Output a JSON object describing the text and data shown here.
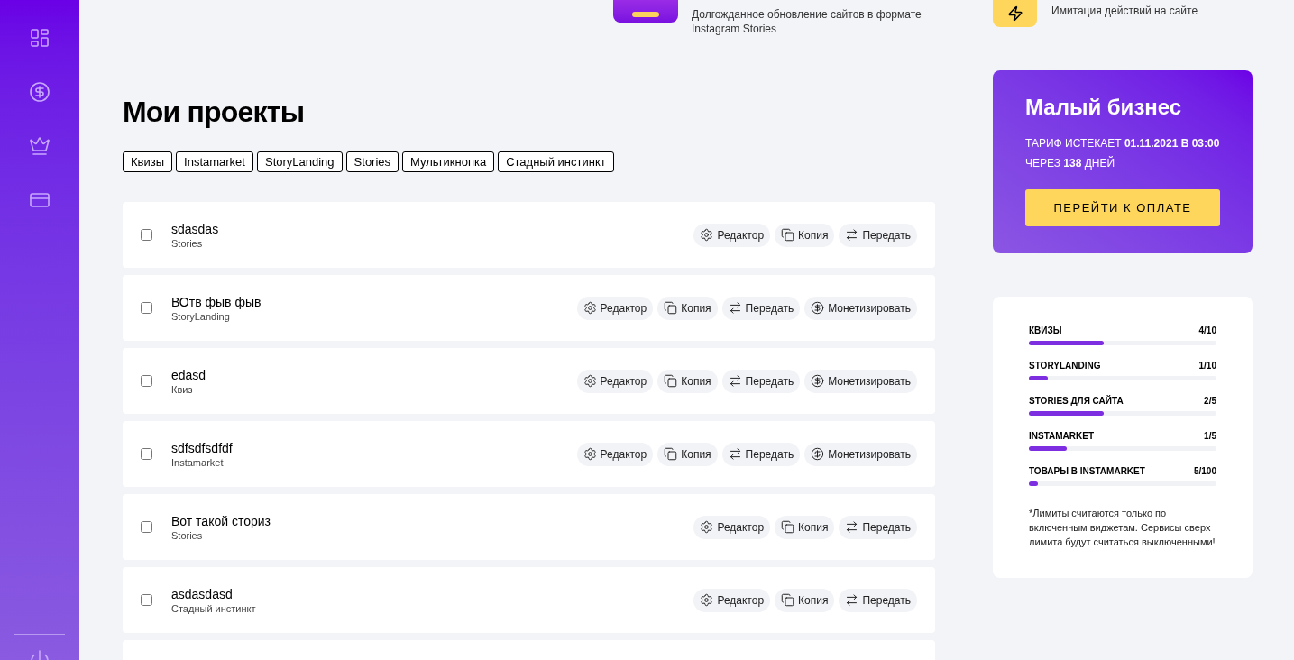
{
  "sidebar": {
    "items": [
      {
        "kind": "dashboard",
        "selected": false
      },
      {
        "kind": "money",
        "selected": false
      },
      {
        "kind": "crown",
        "selected": false
      },
      {
        "kind": "card",
        "selected": false
      }
    ],
    "footer": {
      "kind": "power"
    }
  },
  "promos": [
    {
      "kind": "image",
      "description": "Долгожданное обновление сайтов в формате Instagram Stories"
    },
    {
      "kind": "lightning",
      "description": "Имитация действий на сайте"
    }
  ],
  "title": "Мои проекты",
  "filters": [
    {
      "label": "Квизы",
      "selected": false
    },
    {
      "label": "Instamarket",
      "selected": false
    },
    {
      "label": "StoryLanding",
      "selected": false
    },
    {
      "label": "Stories",
      "selected": false
    },
    {
      "label": "Мультикнопка",
      "selected": false
    },
    {
      "label": "Стадный инстинкт",
      "selected": false
    }
  ],
  "projects": [
    {
      "name": "sdasdas",
      "type": "Stories",
      "checked": false,
      "actions": [
        {
          "kind": "edit",
          "label": "Редактор"
        },
        {
          "kind": "copy",
          "label": "Копия"
        },
        {
          "kind": "transfer",
          "label": "Передать"
        }
      ]
    },
    {
      "name": "ВОтв фыв фыв",
      "type": "StoryLanding",
      "checked": false,
      "actions": [
        {
          "kind": "edit",
          "label": "Редактор"
        },
        {
          "kind": "copy",
          "label": "Копия"
        },
        {
          "kind": "transfer",
          "label": "Передать"
        },
        {
          "kind": "monetize",
          "label": "Монетизировать"
        }
      ]
    },
    {
      "name": "edasd",
      "type": "Квиз",
      "checked": false,
      "actions": [
        {
          "kind": "edit",
          "label": "Редактор"
        },
        {
          "kind": "copy",
          "label": "Копия"
        },
        {
          "kind": "transfer",
          "label": "Передать"
        },
        {
          "kind": "monetize",
          "label": "Монетизировать"
        }
      ]
    },
    {
      "name": "sdfsdfsdfdf",
      "type": "Instamarket",
      "checked": false,
      "actions": [
        {
          "kind": "edit",
          "label": "Редактор"
        },
        {
          "kind": "copy",
          "label": "Копия"
        },
        {
          "kind": "transfer",
          "label": "Передать"
        },
        {
          "kind": "monetize",
          "label": "Монетизировать"
        }
      ]
    },
    {
      "name": "Вот такой сториз",
      "type": "Stories",
      "checked": false,
      "actions": [
        {
          "kind": "edit",
          "label": "Редактор"
        },
        {
          "kind": "copy",
          "label": "Копия"
        },
        {
          "kind": "transfer",
          "label": "Передать"
        }
      ]
    },
    {
      "name": "asdasdasd",
      "type": "Стадный инстинкт",
      "checked": false,
      "actions": [
        {
          "kind": "edit",
          "label": "Редактор"
        },
        {
          "kind": "copy",
          "label": "Копия"
        },
        {
          "kind": "transfer",
          "label": "Передать"
        }
      ]
    }
  ],
  "plan": {
    "name": "Малый бизнес",
    "expiry": "ТАРИФ ИСТЕКАЕТ **01.11.2021 В 03:00** ЧЕРЕЗ **138** ДНЕЙ",
    "button": "ПЕРЕЙТИ К ОПЛАТЕ"
  },
  "limits": {
    "items": [
      {
        "label": "КВИЗЫ",
        "count": "4/10",
        "level": 0.4
      },
      {
        "label": "STORYLANDING",
        "count": "1/10",
        "level": 0.1
      },
      {
        "label": "STORIES ДЛЯ САЙТА",
        "count": "2/5",
        "level": 0.4
      },
      {
        "label": "INSTAMARKET",
        "count": "1/5",
        "level": 0.2
      },
      {
        "label": "ТОВАРЫ В INSTAMARKET",
        "count": "5/100",
        "level": 0.05
      }
    ],
    "note": "*Лимиты считаются только по включенным виджетам. Сервисы сверх лимита будут считаться выключенными!"
  }
}
